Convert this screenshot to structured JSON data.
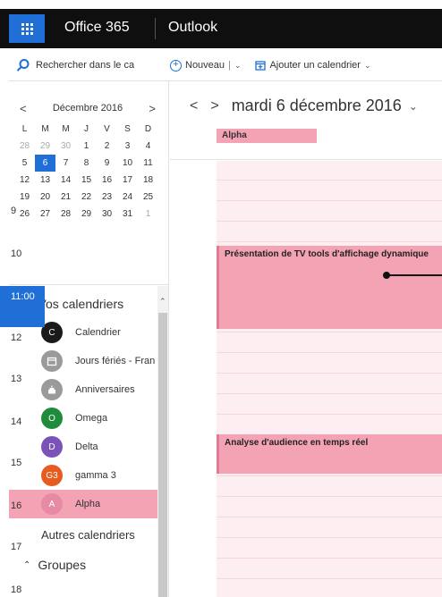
{
  "topbar": {
    "app_name": "Office 365",
    "module_name": "Outlook"
  },
  "search": {
    "placeholder": "Rechercher dans le ca"
  },
  "toolbar": {
    "new_label": "Nouveau",
    "add_calendar_label": "Ajouter un calendrier"
  },
  "mini_calendar": {
    "title": "Décembre 2016",
    "prev": "<",
    "next": ">",
    "weekdays": [
      "L",
      "M",
      "M",
      "J",
      "V",
      "S",
      "D"
    ],
    "weeks": [
      [
        "28",
        "29",
        "30",
        "1",
        "2",
        "3",
        "4"
      ],
      [
        "5",
        "6",
        "7",
        "8",
        "9",
        "10",
        "11"
      ],
      [
        "12",
        "13",
        "14",
        "15",
        "16",
        "17",
        "18"
      ],
      [
        "19",
        "20",
        "21",
        "22",
        "23",
        "24",
        "25"
      ],
      [
        "26",
        "27",
        "28",
        "29",
        "30",
        "31",
        "1"
      ]
    ],
    "selected": "6"
  },
  "sidebar": {
    "your_calendars_label": "Vos calendriers",
    "calendars": [
      {
        "badge": "C",
        "name": "Calendrier",
        "color": "#1a1a1a"
      },
      {
        "badge": "",
        "name": "Jours fériés - Fran",
        "color": "#9a9a9a"
      },
      {
        "badge": "",
        "name": "Anniversaires",
        "color": "#9a9a9a"
      },
      {
        "badge": "O",
        "name": "Omega",
        "color": "#1e8c3a"
      },
      {
        "badge": "D",
        "name": "Delta",
        "color": "#7b52b8"
      },
      {
        "badge": "G3",
        "name": "gamma 3",
        "color": "#e65c1f"
      },
      {
        "badge": "A",
        "name": "Alpha",
        "color": "#e98aa5"
      }
    ],
    "other_calendars_label": "Autres calendriers",
    "groups_label": "Groupes"
  },
  "day_view": {
    "prev": "<",
    "next": ">",
    "date_title": "mardi 6 décembre 2016",
    "all_day_event": "Alpha",
    "hours": [
      "9",
      "10",
      "11:00",
      "12",
      "13",
      "14",
      "15",
      "16",
      "17",
      "18"
    ],
    "current_hour": "11:00",
    "events": [
      {
        "title": "Présentation de TV tools d'affichage dynamique"
      },
      {
        "title": "Analyse d'audience en temps réel"
      }
    ]
  },
  "colors": {
    "accent": "#1f6fd6",
    "alpha_pink": "#f4a3b5"
  }
}
